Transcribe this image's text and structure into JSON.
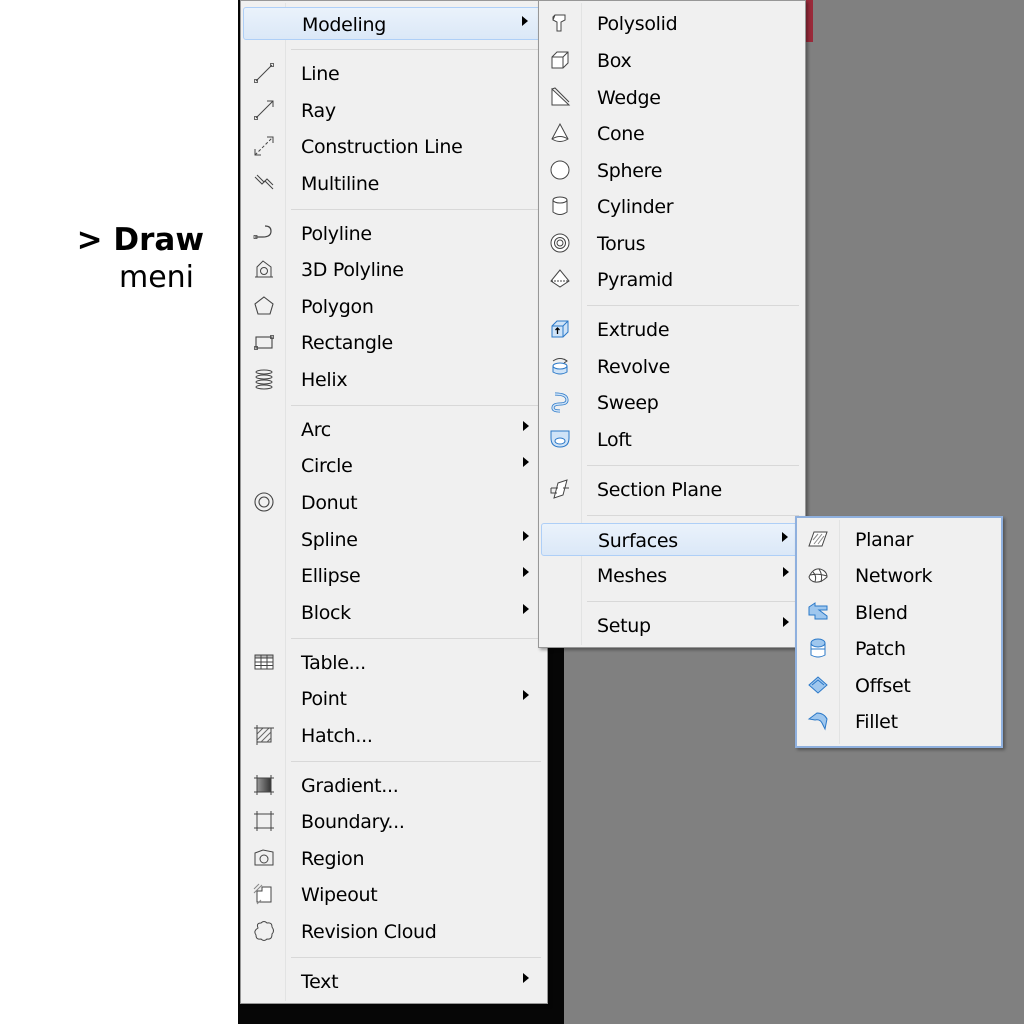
{
  "caption": {
    "title": "> Draw",
    "subtitle": "meni"
  },
  "draw_menu": {
    "modeling": "Modeling",
    "line": "Line",
    "ray": "Ray",
    "construction_line": "Construction Line",
    "multiline": "Multiline",
    "polyline": "Polyline",
    "polyline3d": "3D Polyline",
    "polygon": "Polygon",
    "rectangle": "Rectangle",
    "helix": "Helix",
    "arc": "Arc",
    "circle": "Circle",
    "donut": "Donut",
    "spline": "Spline",
    "ellipse": "Ellipse",
    "block": "Block",
    "table": "Table...",
    "point": "Point",
    "hatch": "Hatch...",
    "gradient": "Gradient...",
    "boundary": "Boundary...",
    "region": "Region",
    "wipeout": "Wipeout",
    "revision_cloud": "Revision Cloud",
    "text": "Text"
  },
  "modeling_menu": {
    "polysolid": "Polysolid",
    "box": "Box",
    "wedge": "Wedge",
    "cone": "Cone",
    "sphere": "Sphere",
    "cylinder": "Cylinder",
    "torus": "Torus",
    "pyramid": "Pyramid",
    "extrude": "Extrude",
    "revolve": "Revolve",
    "sweep": "Sweep",
    "loft": "Loft",
    "section_plane": "Section Plane",
    "surfaces": "Surfaces",
    "meshes": "Meshes",
    "setup": "Setup"
  },
  "surfaces_menu": {
    "planar": "Planar",
    "network": "Network",
    "blend": "Blend",
    "patch": "Patch",
    "offset": "Offset",
    "fillet": "Fillet"
  },
  "colors": {
    "highlight_border": "#aecff7",
    "icon_blue": "#2a78c8",
    "menu_bg": "#f0f0f0"
  }
}
